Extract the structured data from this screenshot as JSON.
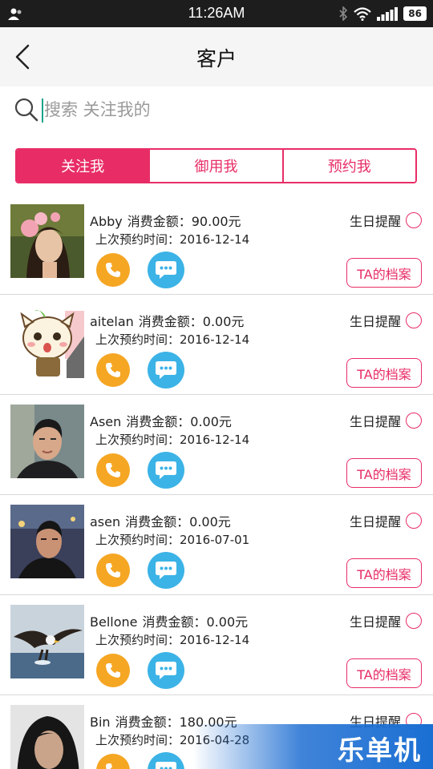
{
  "status_bar": {
    "time": "11:26AM",
    "battery": "86"
  },
  "header": {
    "title": "客户"
  },
  "search": {
    "placeholder": "搜索 关注我的"
  },
  "tabs": [
    {
      "label": "关注我",
      "active": true
    },
    {
      "label": "御用我",
      "active": false
    },
    {
      "label": "预约我",
      "active": false
    }
  ],
  "list": {
    "amount_label": "消费金额：",
    "last_visit_label": "上次预约时间：",
    "birthday_label": "生日提醒",
    "profile_label": "TA的档案",
    "customers": [
      {
        "name": "Abby",
        "amount": "90.00元",
        "date": "2016-12-14"
      },
      {
        "name": "aitelan",
        "amount": "0.00元",
        "date": "2016-12-14"
      },
      {
        "name": "Asen",
        "amount": "0.00元",
        "date": "2016-12-14"
      },
      {
        "name": "asen",
        "amount": "0.00元",
        "date": "2016-07-01"
      },
      {
        "name": "Bellone",
        "amount": "0.00元",
        "date": "2016-12-14"
      },
      {
        "name": "Bin",
        "amount": "180.00元",
        "date": "2016-04-28"
      }
    ]
  },
  "watermark": {
    "text": "乐单机"
  },
  "colors": {
    "accent": "#e82d66",
    "call": "#f5a623",
    "message": "#3cb3e6",
    "status_bar": "#1d1d1d"
  },
  "icons": [
    "user-icon",
    "bluetooth-icon",
    "wifi-icon",
    "signal-icon",
    "battery-icon",
    "back-icon",
    "search-icon",
    "phone-icon",
    "chat-icon"
  ]
}
